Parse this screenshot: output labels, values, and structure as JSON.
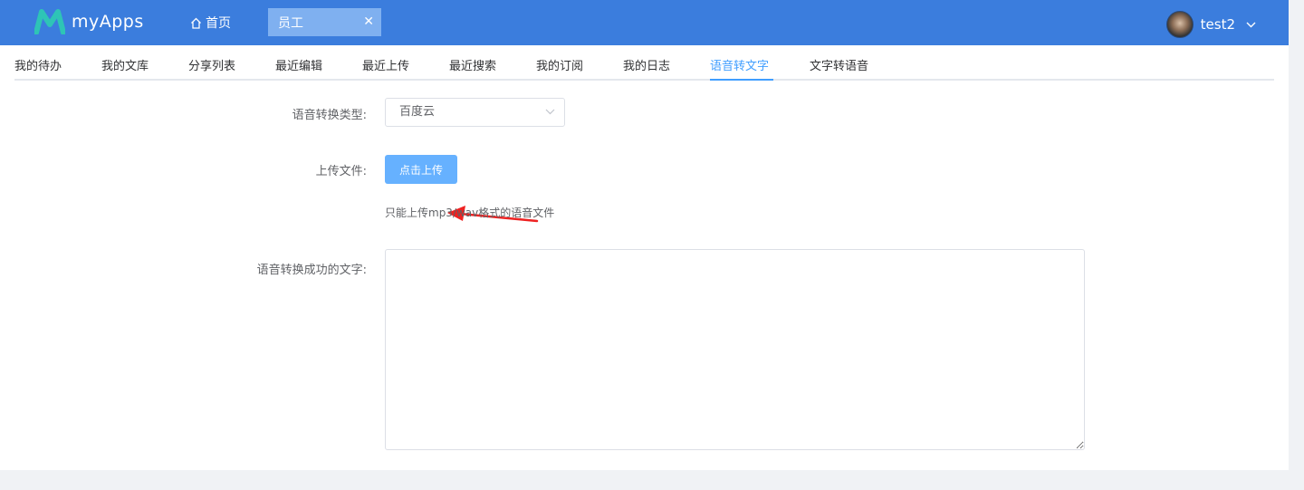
{
  "header": {
    "app_name": "myApps",
    "home_label": "首页",
    "open_tab": {
      "label": "员工",
      "close_symbol": "✕"
    },
    "user": {
      "name": "test2"
    }
  },
  "nav": {
    "tabs": [
      {
        "label": "我的待办"
      },
      {
        "label": "我的文库"
      },
      {
        "label": "分享列表"
      },
      {
        "label": "最近编辑"
      },
      {
        "label": "最近上传"
      },
      {
        "label": "最近搜索"
      },
      {
        "label": "我的订阅"
      },
      {
        "label": "我的日志"
      },
      {
        "label": "语音转文字",
        "active": true
      },
      {
        "label": "文字转语音"
      }
    ]
  },
  "form": {
    "type_label": "语音转换类型:",
    "type_value": "百度云",
    "upload_label": "上传文件:",
    "upload_button": "点击上传",
    "upload_hint": "只能上传mp3/wav格式的语音文件",
    "result_label": "语音转换成功的文字:",
    "result_value": ""
  },
  "colors": {
    "header_bg": "#3b7ddd",
    "accent": "#409eff",
    "upload_button_bg": "#66b1ff",
    "annotation_arrow": "#ee2222"
  }
}
